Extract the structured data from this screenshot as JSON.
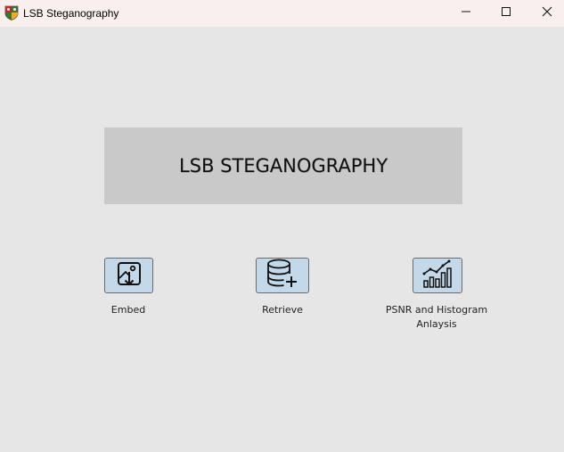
{
  "window": {
    "title": "LSB Steganography",
    "app_icon": "shield-crest-icon",
    "controls": {
      "minimize_icon": "minimize-icon",
      "maximize_icon": "maximize-icon",
      "close_icon": "close-icon"
    }
  },
  "banner": {
    "title": "LSB STEGANOGRAPHY"
  },
  "actions": [
    {
      "label": "Embed",
      "icon": "image-download-icon"
    },
    {
      "label": "Retrieve",
      "icon": "database-add-icon"
    },
    {
      "label": "PSNR and Histogram",
      "label_line2": "Anlaysis",
      "icon": "bar-chart-trend-icon"
    }
  ],
  "colors": {
    "background": "#e6e6e6",
    "titlebar": "#f9efee",
    "banner": "#c9c9c9",
    "button_fill": "#c3d9ea",
    "button_border": "#6a6a6a"
  }
}
